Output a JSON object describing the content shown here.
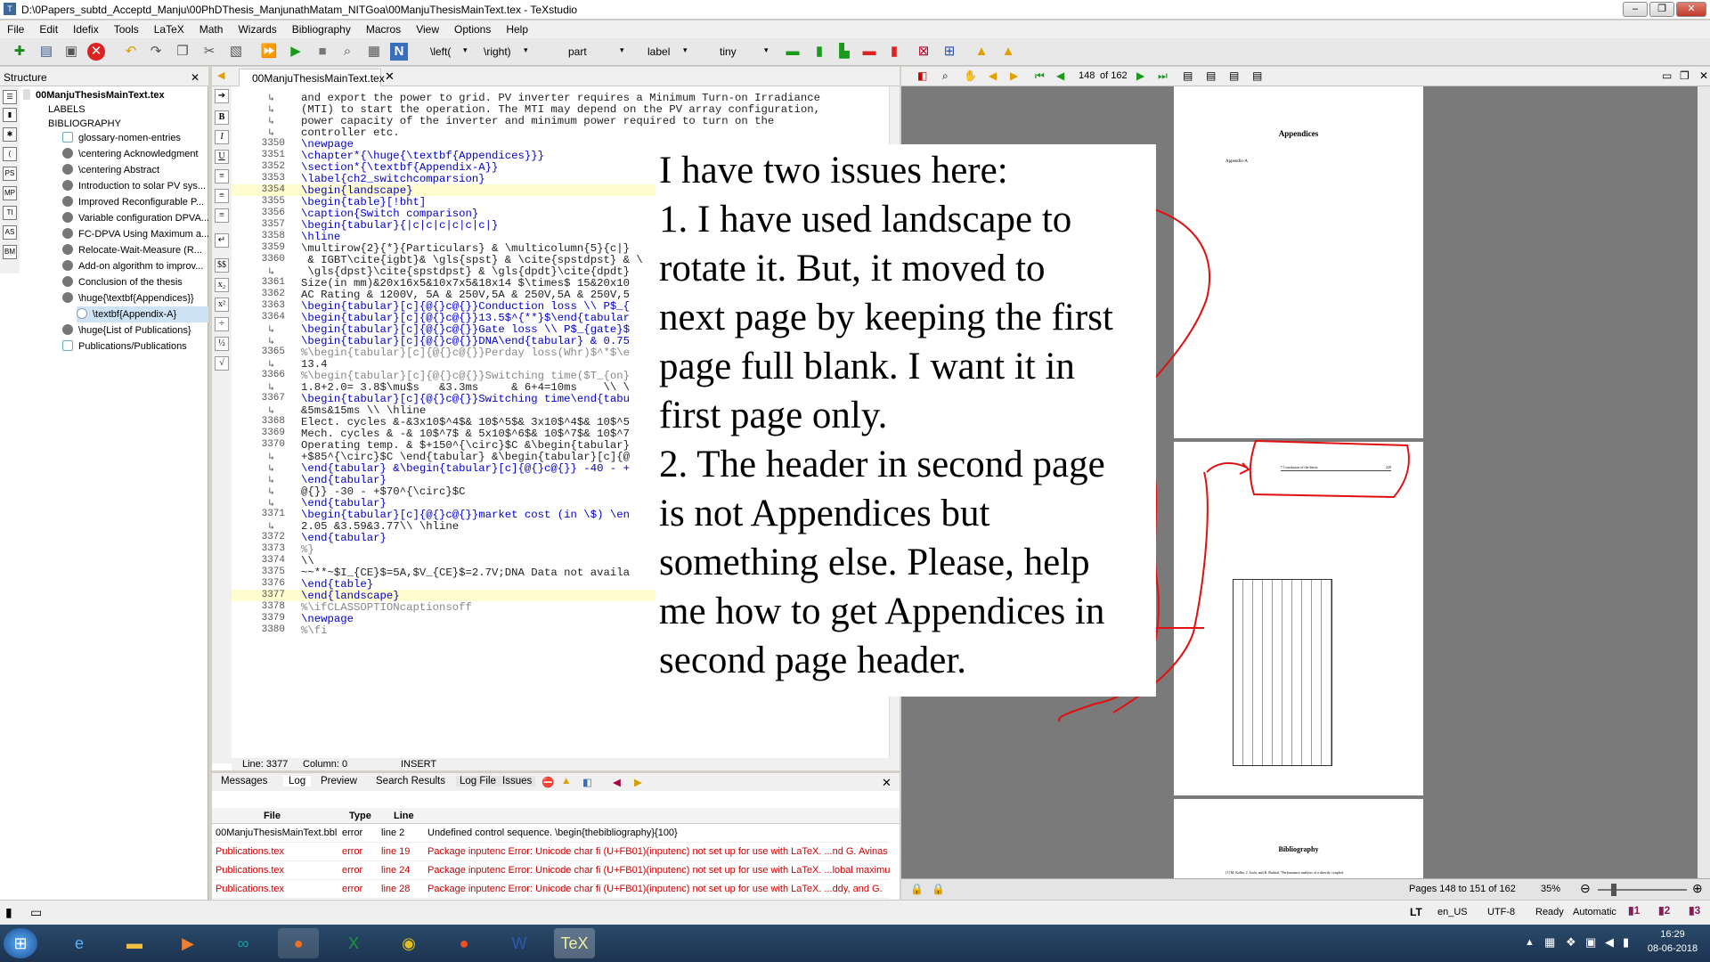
{
  "titlebar": {
    "title": "D:\\0Papers_subtd_Acceptd_Manju\\00PhDThesis_ManjunathMatam_NITGoa\\00ManjuThesisMainText.tex - TeXstudio"
  },
  "menu": [
    "File",
    "Edit",
    "Idefix",
    "Tools",
    "LaTeX",
    "Math",
    "Wizards",
    "Bibliography",
    "Macros",
    "View",
    "Options",
    "Help"
  ],
  "toolbar": {
    "left_delim": "\\left(",
    "right_delim": "\\right)",
    "sectioning": "part",
    "ref": "label",
    "size": "tiny"
  },
  "structure": {
    "title": "Structure",
    "root": "00ManjuThesisMainText.tex",
    "items": [
      "LABELS",
      "BIBLIOGRAPHY",
      "glossary-nomen-entries",
      "\\centering Acknowledgment",
      "\\centering Abstract",
      "Introduction to solar PV sys...",
      "Improved Reconfigurable P...",
      "Variable configuration DPVA...",
      "FC-DPVA Using Maximum a...",
      "Relocate-Wait-Measure (R...",
      "Add-on algorithm to improv...",
      "Conclusion of the thesis",
      "\\huge{\\textbf{Appendices}}",
      "\\textbf{Appendix-A}",
      "\\huge{List of Publications}",
      "Publications/Publications"
    ]
  },
  "editor": {
    "tab": "00ManjuThesisMainText.tex",
    "lines": [
      {
        "n": "",
        "t": "and export the power to grid. PV inverter requires a Minimum Turn-on Irradiance"
      },
      {
        "n": "",
        "t": "(MTI) to start the operation. The MTI may depend on the PV array configuration,"
      },
      {
        "n": "",
        "t": "power capacity of the inverter and minimum power required to turn on the"
      },
      {
        "n": "",
        "t": "controller etc."
      },
      {
        "n": "3350",
        "t": "\\newpage"
      },
      {
        "n": "3351",
        "t": "\\chapter*{\\huge{\\textbf{Appendices}}}"
      },
      {
        "n": "3352",
        "t": "\\section*{\\textbf{Appendix-A}}"
      },
      {
        "n": "3353",
        "t": "\\label{ch2_switchcomparsion}"
      },
      {
        "n": "3354",
        "t": "\\begin{landscape}"
      },
      {
        "n": "3355",
        "t": "\\begin{table}[!bht]"
      },
      {
        "n": "3356",
        "t": "\\caption{Switch comparison}"
      },
      {
        "n": "3357",
        "t": "\\begin{tabular}{|c|c|c|c|c|c|}"
      },
      {
        "n": "3358",
        "t": "\\hline"
      },
      {
        "n": "3359",
        "t": "\\multirow{2}{*}{Particulars} & \\multicolumn{5}{c|}"
      },
      {
        "n": "3360",
        "t": " & IGBT\\cite{igbt}& \\gls{spst} & \\cite{spstdpst} & \\"
      },
      {
        "n": "",
        "t": " \\gls{dpst}\\cite{spstdpst} & \\gls{dpdt}\\cite{dpdt}"
      },
      {
        "n": "3361",
        "t": "Size(in mm)&20x16x5&10x7x5&18x14 $\\times$ 15&20x10"
      },
      {
        "n": "3362",
        "t": "AC Rating & 1200V, 5A & 250V,5A & 250V,5A & 250V,5"
      },
      {
        "n": "3363",
        "t": "\\begin{tabular}[c]{@{}c@{}}Conduction loss \\\\ P$_{"
      },
      {
        "n": "3364",
        "t": "\\begin{tabular}[c]{@{}c@{}}13.5$^{**}$\\end{tabular"
      },
      {
        "n": "",
        "t": "\\begin{tabular}[c]{@{}c@{}}Gate loss \\\\ P$_{gate}$"
      },
      {
        "n": "",
        "t": "\\begin{tabular}[c]{@{}c@{}}DNA\\end{tabular} & 0.75"
      },
      {
        "n": "3365",
        "t": "%\\begin{tabular}[c]{@{}c@{}}Perday loss(Whr)$^*$\\e"
      },
      {
        "n": "",
        "t": "13.4"
      },
      {
        "n": "3366",
        "t": "%\\begin{tabular}[c]{@{}c@{}}Switching time($T_{on}"
      },
      {
        "n": "",
        "t": "1.8+2.0= 3.8$\\mu$s   &3.3ms     & 6+4=10ms    \\\\ \\"
      },
      {
        "n": "3367",
        "t": "\\begin{tabular}[c]{@{}c@{}}Switching time\\end{tabu"
      },
      {
        "n": "",
        "t": "&5ms&15ms \\\\ \\hline"
      },
      {
        "n": "3368",
        "t": "Elect. cycles &-&3x10$^4$& 10$^5$& 3x10$^4$& 10$^5"
      },
      {
        "n": "3369",
        "t": "Mech. cycles & -& 10$^7$ & 5x10$^6$& 10$^7$& 10$^7"
      },
      {
        "n": "3370",
        "t": "Operating temp. & $+150^{\\circ}$C &\\begin{tabular}"
      },
      {
        "n": "",
        "t": "+$85^{\\circ}$C \\end{tabular} &\\begin{tabular}[c]{@"
      },
      {
        "n": "",
        "t": "\\end{tabular} &\\begin{tabular}[c]{@{}c@{}} -40 - +"
      },
      {
        "n": "",
        "t": "\\end{tabular}"
      },
      {
        "n": "",
        "t": "@{}} -30 - +$70^{\\circ}$C"
      },
      {
        "n": "",
        "t": "\\end{tabular}"
      },
      {
        "n": "3371",
        "t": "\\begin{tabular}[c]{@{}c@{}}market cost (in \\$) \\en"
      },
      {
        "n": "",
        "t": "2.05 &3.59&3.77\\\\ \\hline"
      },
      {
        "n": "3372",
        "t": "\\end{tabular}"
      },
      {
        "n": "3373",
        "t": "%}"
      },
      {
        "n": "3374",
        "t": "\\\\"
      },
      {
        "n": "3375",
        "t": "~~**~$I_{CE}$=5A,$V_{CE}$=2.7V;DNA Data not availa"
      },
      {
        "n": "3376",
        "t": "\\end{table}"
      },
      {
        "n": "3377",
        "t": "\\end{landscape}"
      },
      {
        "n": "3378",
        "t": "%\\ifCLASSOPTIONcaptionsoff"
      },
      {
        "n": "3379",
        "t": "\\newpage"
      },
      {
        "n": "3380",
        "t": "%\\fi"
      }
    ],
    "status": {
      "line": "Line: 3377",
      "column": "Column: 0",
      "mode": "INSERT"
    }
  },
  "messages": {
    "tabs": [
      "Messages",
      "Log",
      "Preview",
      "Search Results",
      "Log File",
      "Issues"
    ],
    "headers": [
      "File",
      "Type",
      "Line"
    ],
    "rows": [
      {
        "file": "00ManjuThesisMainText.bbl",
        "type": "error",
        "line": "line 2",
        "msg": "Undefined control sequence. \\begin{thebibliography}{100}"
      },
      {
        "file": "Publications.tex",
        "type": "error",
        "line": "line 19",
        "msg": "Package inputenc Error: Unicode char fi (U+FB01)(inputenc) not set up for use with LaTeX. ...nd G. Avinas"
      },
      {
        "file": "Publications.tex",
        "type": "error",
        "line": "line 24",
        "msg": "Package inputenc Error: Unicode char fi (U+FB01)(inputenc) not set up for use with LaTeX. ...lobal maximu"
      },
      {
        "file": "Publications.tex",
        "type": "error",
        "line": "line 28",
        "msg": "Package inputenc Error: Unicode char fi (U+FB01)(inputenc) not set up for use with LaTeX. ...ddy, and G."
      }
    ]
  },
  "pdf": {
    "page_info": "148",
    "page_total": "of 162",
    "page1_title": "Appendices",
    "page1_sub": "Appendix-A",
    "page2_header_left": "7   Conclusion of the thesis",
    "page2_header_right": "229",
    "page3_title": "Bibliography",
    "page3_text": "[1] M. Kolbe, J. Joshi, and R. Rathod, \"Performance analysis of a directly coupled",
    "pages_status": "Pages 148 to 151 of 162",
    "zoom": "35%"
  },
  "overlay": {
    "lines": [
      "I have two issues here:",
      "1. I have used landscape to",
      "rotate it. But, it moved to",
      "next page by keeping the first",
      "page full blank. I want it in",
      "first page only.",
      "2. The header in second page",
      "is not Appendices but",
      "something else. Please, help",
      "me how to get Appendices in",
      "second page header."
    ]
  },
  "statusbar": {
    "lang": "en_US",
    "encoding": "UTF-8",
    "ready": "Ready",
    "mode": "Automatic"
  },
  "taskbar": {
    "time": "16:29",
    "date": "08-06-2018"
  },
  "colors": {
    "annotation": "#e01010",
    "highlight": "#fffccf",
    "keyword": "#0000cc",
    "error": "#cc0000"
  }
}
